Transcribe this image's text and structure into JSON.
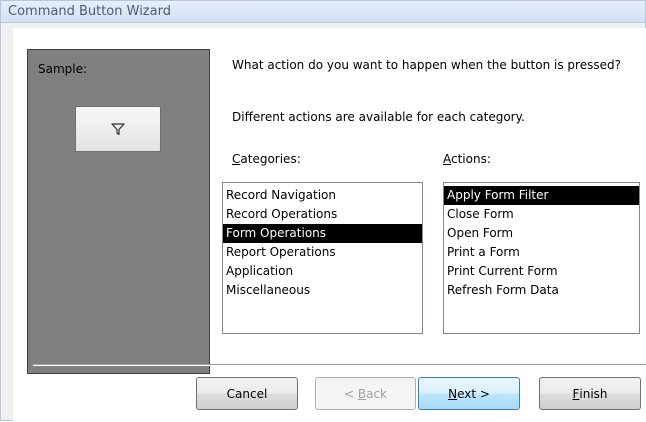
{
  "window": {
    "title": "Command Button Wizard"
  },
  "sample": {
    "label": "Sample:",
    "button_icon": "filter-funnel-icon"
  },
  "prompt": {
    "question": "What action do you want to happen when the button is pressed?",
    "subtext": "Different actions are available for each category."
  },
  "categories": {
    "label_accel": "C",
    "label_rest": "ategories:",
    "items": [
      {
        "label": "Record Navigation",
        "selected": false
      },
      {
        "label": "Record Operations",
        "selected": false
      },
      {
        "label": "Form Operations",
        "selected": true
      },
      {
        "label": "Report Operations",
        "selected": false
      },
      {
        "label": "Application",
        "selected": false
      },
      {
        "label": "Miscellaneous",
        "selected": false
      }
    ]
  },
  "actions": {
    "label_accel": "A",
    "label_rest": "ctions:",
    "items": [
      {
        "label": "Apply Form Filter",
        "selected": true
      },
      {
        "label": "Close Form",
        "selected": false
      },
      {
        "label": "Open Form",
        "selected": false
      },
      {
        "label": "Print a Form",
        "selected": false
      },
      {
        "label": "Print Current Form",
        "selected": false
      },
      {
        "label": "Refresh Form Data",
        "selected": false
      }
    ]
  },
  "buttons": {
    "cancel": {
      "label": "Cancel"
    },
    "back": {
      "pre": "< ",
      "accel": "B",
      "rest": "ack",
      "enabled": false
    },
    "next": {
      "accel": "N",
      "rest": "ext >",
      "default": true
    },
    "finish": {
      "accel": "F",
      "rest": "inish"
    }
  },
  "colors": {
    "title_text": "#4b5c78",
    "sample_panel": "#808080",
    "selection": "#000000"
  }
}
